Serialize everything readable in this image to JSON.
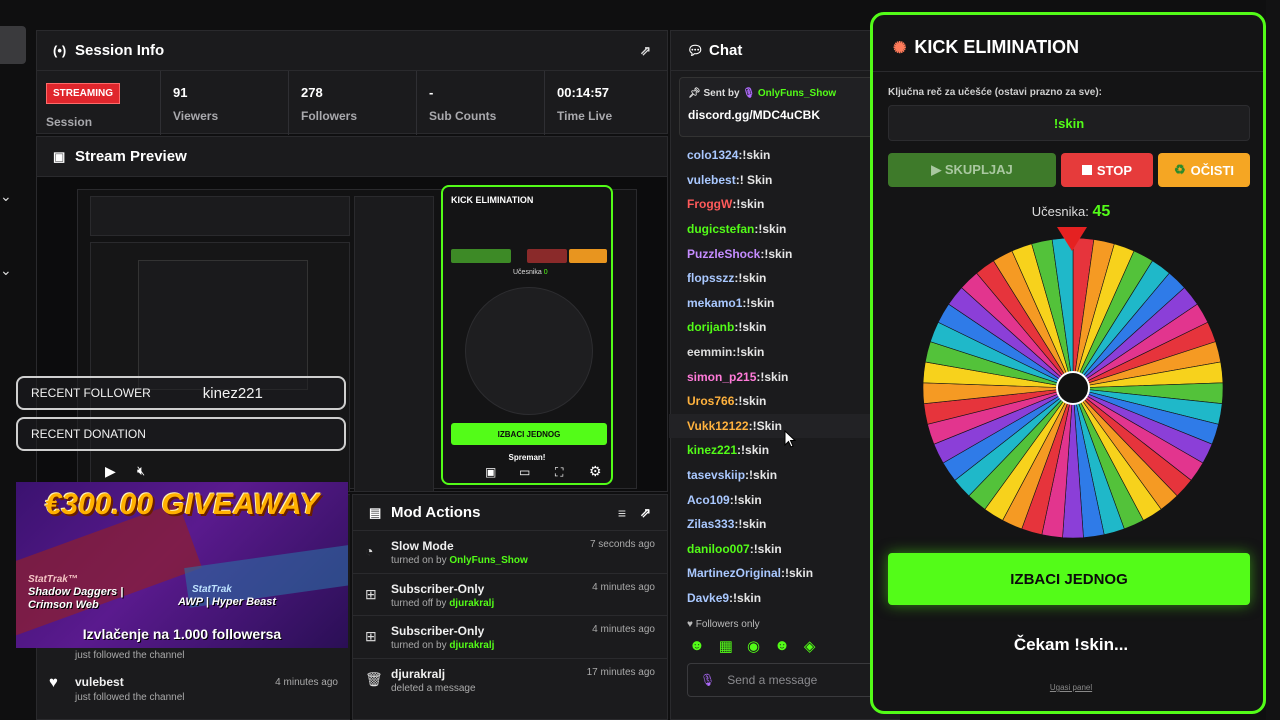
{
  "session_info": {
    "title": "Session Info",
    "badge": "STREAMING",
    "badge_label": "Session",
    "stats": [
      {
        "value": "91",
        "label": "Viewers"
      },
      {
        "value": "278",
        "label": "Followers"
      },
      {
        "value": "-",
        "label": "Sub Counts"
      },
      {
        "value": "00:14:57",
        "label": "Time Live"
      }
    ]
  },
  "stream_preview": {
    "title": "Stream Preview",
    "recent_follower_label": "RECENT FOLLOWER",
    "recent_follower_name": "kinez221",
    "recent_donation_label": "RECENT DONATION",
    "giveaway": {
      "title": "€300.00 GIVEAWAY",
      "item1_brand": "StatTrak™",
      "item1_name": "Shadow Daggers | Crimson Web",
      "item2_brand": "StatTrak",
      "item2_name": "AWP | Hyper Beast",
      "footer": "Izvlačenje na 1.000 followersa"
    },
    "mini_wheel": {
      "title": "KICK ELIMINATION",
      "button": "IZBACI JEDNOG",
      "status": "Spreman!",
      "count_label": "Učesnika",
      "count": "0"
    }
  },
  "activity": [
    {
      "text": "just followed the channel",
      "name": "",
      "time": ""
    },
    {
      "text": "just followed the channel",
      "name": "vulebest",
      "time": "4 minutes ago"
    }
  ],
  "mod_actions": {
    "title": "Mod Actions",
    "rows": [
      {
        "title": "Slow Mode",
        "prefix": "turned on by",
        "by": "OnlyFuns_Show",
        "time": "7 seconds ago"
      },
      {
        "title": "Subscriber-Only",
        "prefix": "turned off by",
        "by": "djurakralj",
        "time": "4 minutes ago"
      },
      {
        "title": "Subscriber-Only",
        "prefix": "turned on by",
        "by": "djurakralj",
        "time": "4 minutes ago"
      },
      {
        "title": "djurakralj",
        "prefix": "deleted a message",
        "by": "",
        "time": "17 minutes ago"
      }
    ]
  },
  "chat": {
    "title": "Chat",
    "pinned_prefix": "Sent by",
    "pinned_user": "OnlyFuns_Show",
    "pinned_text": "discord.gg/MDC4uCBK",
    "messages": [
      {
        "user": "colo1324",
        "color": "#a9c8ff",
        "text": "!skin"
      },
      {
        "user": "vulebest",
        "color": "#a9c8ff",
        "text": "! Skin"
      },
      {
        "user": "FroggW",
        "color": "#ff5a5a",
        "text": "!skin"
      },
      {
        "user": "dugicstefan",
        "color": "#53fc18",
        "text": "!skin"
      },
      {
        "user": "PuzzleShock",
        "color": "#c58cff",
        "text": "!skin"
      },
      {
        "user": "flopsszz",
        "color": "#a9c8ff",
        "text": "!skin"
      },
      {
        "user": "mekamo1",
        "color": "#a9c8ff",
        "text": "!skin"
      },
      {
        "user": "dorijanb",
        "color": "#53fc18",
        "text": "!skin"
      },
      {
        "user": "eemmin",
        "color": "#dddddd",
        "text": "!skin"
      },
      {
        "user": "simon_p215",
        "color": "#ff7ad9",
        "text": "!skin"
      },
      {
        "user": "Uros766",
        "color": "#ffb23e",
        "text": "!skin"
      },
      {
        "user": "Vukk12122",
        "color": "#ffb23e",
        "text": "!Skin"
      },
      {
        "user": "kinez221",
        "color": "#53fc18",
        "text": "!skin"
      },
      {
        "user": "tasevskiip",
        "color": "#a9c8ff",
        "text": "!skin"
      },
      {
        "user": "Aco109",
        "color": "#a9c8ff",
        "text": "!skin"
      },
      {
        "user": "Zilas333",
        "color": "#a9c8ff",
        "text": "!skin"
      },
      {
        "user": "daniloo007",
        "color": "#53fc18",
        "text": "!skin"
      },
      {
        "user": "MartinezOriginal",
        "color": "#a9c8ff",
        "text": "!skin"
      },
      {
        "user": "Davke9",
        "color": "#a9c8ff",
        "text": "!skin"
      }
    ],
    "followers_only": "Followers only",
    "input_placeholder": "Send a message"
  },
  "kick_elimination": {
    "title": "KICK ELIMINATION",
    "keyword_label": "Ključna reč za učešće (ostavi prazno za sve):",
    "keyword_value": "!skin",
    "btn_collect": "▶ SKUPLJAJ",
    "btn_stop": "STOP",
    "btn_clear": "OČISTI",
    "count_label": "Učesnika:",
    "count": "45",
    "eliminate_button": "IZBACI JEDNOG",
    "status": "Čekam !skin...",
    "hide_link": "Ugasi panel",
    "accent": "#53fc18"
  }
}
